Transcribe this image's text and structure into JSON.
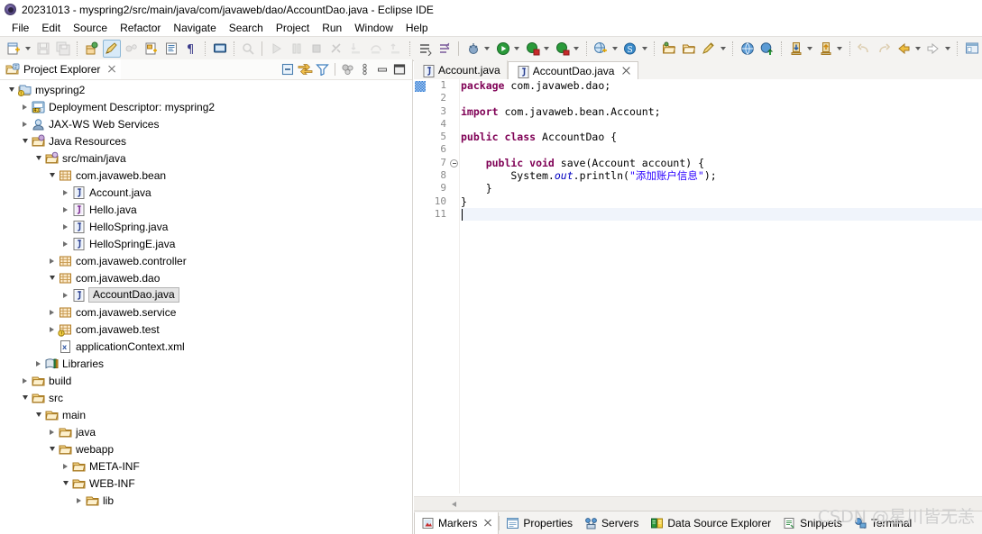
{
  "window": {
    "title": "20231013 - myspring2/src/main/java/com/javaweb/dao/AccountDao.java - Eclipse IDE",
    "icon": "eclipse-icon"
  },
  "menubar": {
    "items": [
      {
        "label": "File"
      },
      {
        "label": "Edit"
      },
      {
        "label": "Source"
      },
      {
        "label": "Refactor"
      },
      {
        "label": "Navigate"
      },
      {
        "label": "Search"
      },
      {
        "label": "Project"
      },
      {
        "label": "Run"
      },
      {
        "label": "Window"
      },
      {
        "label": "Help"
      }
    ]
  },
  "toolbar": {
    "groups": [
      {
        "buttons": [
          {
            "name": "new-icon",
            "dropdown": true
          },
          {
            "name": "save-icon",
            "dropdown": false,
            "disabled": true
          },
          {
            "name": "save-all-icon",
            "dropdown": false,
            "disabled": true
          }
        ]
      },
      {
        "buttons": [
          {
            "name": "new-java-package-icon",
            "dropdown": false
          },
          {
            "name": "toggle-mark-occurrences-icon",
            "dropdown": false,
            "active": true
          },
          {
            "name": "link-with-editor-icon",
            "dropdown": false,
            "disabled": true
          },
          {
            "name": "new-java-class-icon",
            "dropdown": false
          },
          {
            "name": "open-type-icon",
            "dropdown": false
          },
          {
            "name": "show-whitespace-icon",
            "dropdown": false
          }
        ]
      },
      {
        "buttons": [
          {
            "name": "console-icon",
            "dropdown": false
          }
        ]
      },
      {
        "buttons": [
          {
            "name": "search-icon",
            "dropdown": false,
            "disabled": true
          }
        ]
      },
      {
        "buttons": [
          {
            "name": "resume-icon",
            "dropdown": false,
            "disabled": true
          },
          {
            "name": "suspend-icon",
            "dropdown": false,
            "disabled": true
          },
          {
            "name": "terminate-icon",
            "dropdown": false,
            "disabled": true
          },
          {
            "name": "disconnect-icon",
            "dropdown": false,
            "disabled": true
          },
          {
            "name": "step-into-icon",
            "dropdown": false,
            "disabled": true
          },
          {
            "name": "step-over-icon",
            "dropdown": false,
            "disabled": true
          },
          {
            "name": "step-return-icon",
            "dropdown": false,
            "disabled": true
          }
        ]
      },
      {
        "buttons": [
          {
            "name": "next-annotation-icon",
            "dropdown": false
          },
          {
            "name": "previous-annotation-icon",
            "dropdown": false
          }
        ]
      },
      {
        "buttons": [
          {
            "name": "debug-icon",
            "dropdown": true
          },
          {
            "name": "run-icon",
            "dropdown": true
          },
          {
            "name": "coverage-icon",
            "dropdown": true
          },
          {
            "name": "run-as-server-icon",
            "dropdown": true
          }
        ]
      },
      {
        "buttons": [
          {
            "name": "new-web-project-icon",
            "dropdown": true
          },
          {
            "name": "new-spring-element-icon",
            "dropdown": true
          }
        ]
      },
      {
        "buttons": [
          {
            "name": "open-folder-icon",
            "dropdown": false
          },
          {
            "name": "close-folder-icon",
            "dropdown": false
          },
          {
            "name": "quick-access-pencil-icon",
            "dropdown": true
          }
        ]
      },
      {
        "buttons": [
          {
            "name": "open-web-browser-icon",
            "dropdown": false
          },
          {
            "name": "publish-icon",
            "dropdown": false
          }
        ]
      },
      {
        "buttons": [
          {
            "name": "download-icon",
            "dropdown": true
          },
          {
            "name": "upload-icon",
            "dropdown": true
          }
        ]
      },
      {
        "buttons": [
          {
            "name": "undo-icon",
            "dropdown": false,
            "disabled": true
          },
          {
            "name": "redo-icon",
            "dropdown": false,
            "disabled": true
          },
          {
            "name": "back-icon",
            "dropdown": true
          },
          {
            "name": "forward-icon",
            "dropdown": true
          }
        ]
      },
      {
        "buttons": [
          {
            "name": "perspective-java-ee-icon",
            "dropdown": false
          }
        ]
      }
    ]
  },
  "explorer": {
    "tab_label": "Project Explorer",
    "tab_icon": "project-explorer-icon",
    "tools": [
      {
        "name": "collapse-all-icon"
      },
      {
        "name": "link-with-editor-icon"
      },
      {
        "name": "view-filter-icon"
      },
      {
        "name": "focus-on-active-task-icon"
      },
      {
        "name": "view-menu-icon"
      },
      {
        "name": "minimize-icon"
      },
      {
        "name": "maximize-icon"
      }
    ],
    "tree": [
      {
        "label": "myspring2",
        "depth": 0,
        "twisty": "down",
        "icon": "java-web-project-icon"
      },
      {
        "label": "Deployment Descriptor: myspring2",
        "depth": 1,
        "twisty": "right",
        "icon": "deployment-descriptor-icon"
      },
      {
        "label": "JAX-WS Web Services",
        "depth": 1,
        "twisty": "right",
        "icon": "jaxws-icon"
      },
      {
        "label": "Java Resources",
        "depth": 1,
        "twisty": "down",
        "icon": "java-resources-icon"
      },
      {
        "label": "src/main/java",
        "depth": 2,
        "twisty": "down",
        "icon": "source-folder-icon"
      },
      {
        "label": "com.javaweb.bean",
        "depth": 3,
        "twisty": "down",
        "icon": "package-icon"
      },
      {
        "label": "Account.java",
        "depth": 4,
        "twisty": "right",
        "icon": "java-class-file-icon"
      },
      {
        "label": "Hello.java",
        "depth": 4,
        "twisty": "right",
        "icon": "java-interface-file-icon"
      },
      {
        "label": "HelloSpring.java",
        "depth": 4,
        "twisty": "right",
        "icon": "java-class-file-icon"
      },
      {
        "label": "HelloSpringE.java",
        "depth": 4,
        "twisty": "right",
        "icon": "java-class-file-icon"
      },
      {
        "label": "com.javaweb.controller",
        "depth": 3,
        "twisty": "right",
        "icon": "package-icon"
      },
      {
        "label": "com.javaweb.dao",
        "depth": 3,
        "twisty": "down",
        "icon": "package-icon"
      },
      {
        "label": "AccountDao.java",
        "depth": 4,
        "twisty": "right",
        "icon": "java-class-file-icon",
        "selected": true
      },
      {
        "label": "com.javaweb.service",
        "depth": 3,
        "twisty": "right",
        "icon": "package-icon"
      },
      {
        "label": "com.javaweb.test",
        "depth": 3,
        "twisty": "right",
        "icon": "package-warning-icon"
      },
      {
        "label": "applicationContext.xml",
        "depth": 3,
        "twisty": "none",
        "icon": "xml-file-icon"
      },
      {
        "label": "Libraries",
        "depth": 2,
        "twisty": "right",
        "icon": "libraries-icon"
      },
      {
        "label": "build",
        "depth": 1,
        "twisty": "right",
        "icon": "folder-icon"
      },
      {
        "label": "src",
        "depth": 1,
        "twisty": "down",
        "icon": "folder-icon"
      },
      {
        "label": "main",
        "depth": 2,
        "twisty": "down",
        "icon": "folder-icon"
      },
      {
        "label": "java",
        "depth": 3,
        "twisty": "right",
        "icon": "folder-icon"
      },
      {
        "label": "webapp",
        "depth": 3,
        "twisty": "down",
        "icon": "folder-icon"
      },
      {
        "label": "META-INF",
        "depth": 4,
        "twisty": "right",
        "icon": "folder-icon"
      },
      {
        "label": "WEB-INF",
        "depth": 4,
        "twisty": "down",
        "icon": "folder-icon"
      },
      {
        "label": "lib",
        "depth": 5,
        "twisty": "right",
        "icon": "folder-icon"
      }
    ]
  },
  "editor": {
    "tabs": [
      {
        "label": "Account.java",
        "icon": "java-class-file-icon",
        "active": false,
        "closable": false
      },
      {
        "label": "AccountDao.java",
        "icon": "java-class-file-icon",
        "active": true,
        "closable": true
      }
    ],
    "line_numbers": [
      "1",
      "2",
      "3",
      "4",
      "5",
      "6",
      "7",
      "8",
      "9",
      "10",
      "11"
    ],
    "fold_marker_line": 7,
    "caret_line": 11,
    "code_lines": [
      [
        {
          "t": "package ",
          "c": "kw"
        },
        {
          "t": "com.javaweb.dao;",
          "c": ""
        }
      ],
      [],
      [
        {
          "t": "import ",
          "c": "kw"
        },
        {
          "t": "com.javaweb.bean.Account;",
          "c": ""
        }
      ],
      [],
      [
        {
          "t": "public class ",
          "c": "kw"
        },
        {
          "t": "AccountDao {",
          "c": ""
        }
      ],
      [],
      [
        {
          "t": "    public void ",
          "c": "kw"
        },
        {
          "t": "save(Account account) {",
          "c": ""
        }
      ],
      [
        {
          "t": "        System.",
          "c": ""
        },
        {
          "t": "out",
          "c": "fld"
        },
        {
          "t": ".println(",
          "c": ""
        },
        {
          "t": "\"添加账户信息\"",
          "c": "str"
        },
        {
          "t": ");",
          "c": ""
        }
      ],
      [
        {
          "t": "    }",
          "c": ""
        }
      ],
      [
        {
          "t": "}",
          "c": ""
        }
      ],
      []
    ],
    "scroll_left_arrow": "scroll-left-icon"
  },
  "bottom_tabs": [
    {
      "label": "Markers",
      "icon": "markers-icon",
      "active": true,
      "closable": true
    },
    {
      "label": "Properties",
      "icon": "properties-icon",
      "active": false,
      "closable": false
    },
    {
      "label": "Servers",
      "icon": "servers-icon",
      "active": false,
      "closable": false
    },
    {
      "label": "Data Source Explorer",
      "icon": "data-source-explorer-icon",
      "active": false,
      "closable": false
    },
    {
      "label": "Snippets",
      "icon": "snippets-icon",
      "active": false,
      "closable": false
    },
    {
      "label": "Terminal",
      "icon": "terminal-icon",
      "active": false,
      "closable": false
    }
  ],
  "watermark": {
    "text": "CSDN @星川皆无恙"
  },
  "colors": {
    "keyword": "#7f0055",
    "string": "#2a00ff",
    "field": "#0000c0",
    "selection_bg": "#e4e4e4",
    "toolbar_bg": "#f4f3f1",
    "active_toggle_bg": "#d8eaf8"
  }
}
